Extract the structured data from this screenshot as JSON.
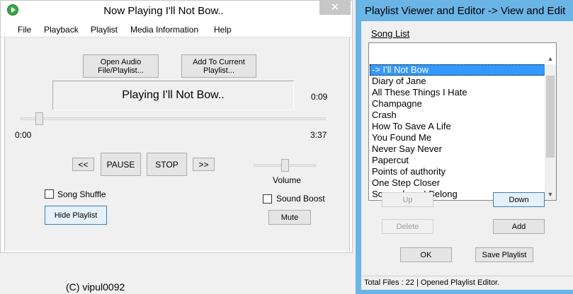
{
  "player": {
    "title": "Now Playing I'll Not Bow..",
    "close_icon": "close-icon",
    "menu": [
      "File",
      "Playback",
      "Playlist",
      "Media Information",
      "Help"
    ],
    "open_button": "Open Audio File/Playlist...",
    "add_button": "Add To Current Playlist...",
    "now_playing_text": "Playing I'll Not Bow..",
    "elapsed": "0:09",
    "start_time": "0:00",
    "duration": "3:37",
    "position_fraction": 0.05,
    "prev_button": "<<",
    "pause_button": "PAUSE",
    "stop_button": "STOP",
    "next_button": ">>",
    "volume_label": "Volume",
    "volume_fraction": 0.5,
    "song_shuffle_label": "Song Shuffle",
    "song_shuffle_checked": false,
    "sound_boost_label": "Sound Boost",
    "sound_boost_checked": false,
    "mute_button": "Mute",
    "hide_playlist_button": "Hide Playlist"
  },
  "footer": "(C) vipul0092",
  "playlist": {
    "title": "Playlist Viewer and Editor -> View and Edit",
    "list_header": "Song List",
    "songs": [
      "-> I'll Not Bow",
      "Diary of Jane",
      "All These Things I Hate",
      "Champagne",
      "Crash",
      "How To Save A Life",
      "You Found Me",
      "Never Say Never",
      "Papercut",
      "Points of authority",
      "One Step Closer",
      "Somewhere I Belong"
    ],
    "selected_index": 0,
    "up_button": "Up",
    "down_button": "Down",
    "delete_button": "Delete",
    "add_button": "Add",
    "ok_button": "OK",
    "save_button": "Save Playlist",
    "status": "Total Files : 22  | Opened Playlist Editor."
  },
  "colors": {
    "playlist_frame": "#6bb4e6",
    "selection": "#3399ff"
  }
}
